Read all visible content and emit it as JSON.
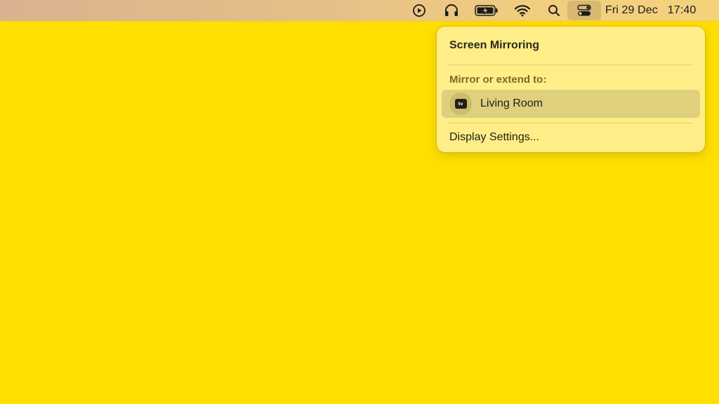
{
  "menubar": {
    "icons": [
      "play-circle-icon",
      "headphones-icon",
      "battery-charging-icon",
      "wifi-icon",
      "search-icon",
      "control-center-icon"
    ],
    "date": "Fri 29 Dec",
    "time": "17:40"
  },
  "screen_mirroring": {
    "title": "Screen Mirroring",
    "section_label": "Mirror or extend to:",
    "devices": [
      {
        "name": "Living Room",
        "icon": "apple-tv-icon",
        "icon_text": "tv"
      }
    ],
    "display_settings_label": "Display Settings..."
  },
  "colors": {
    "desktop": "#FFDF00",
    "panel": "#FFEE88",
    "selected_row": "#DED07D"
  }
}
